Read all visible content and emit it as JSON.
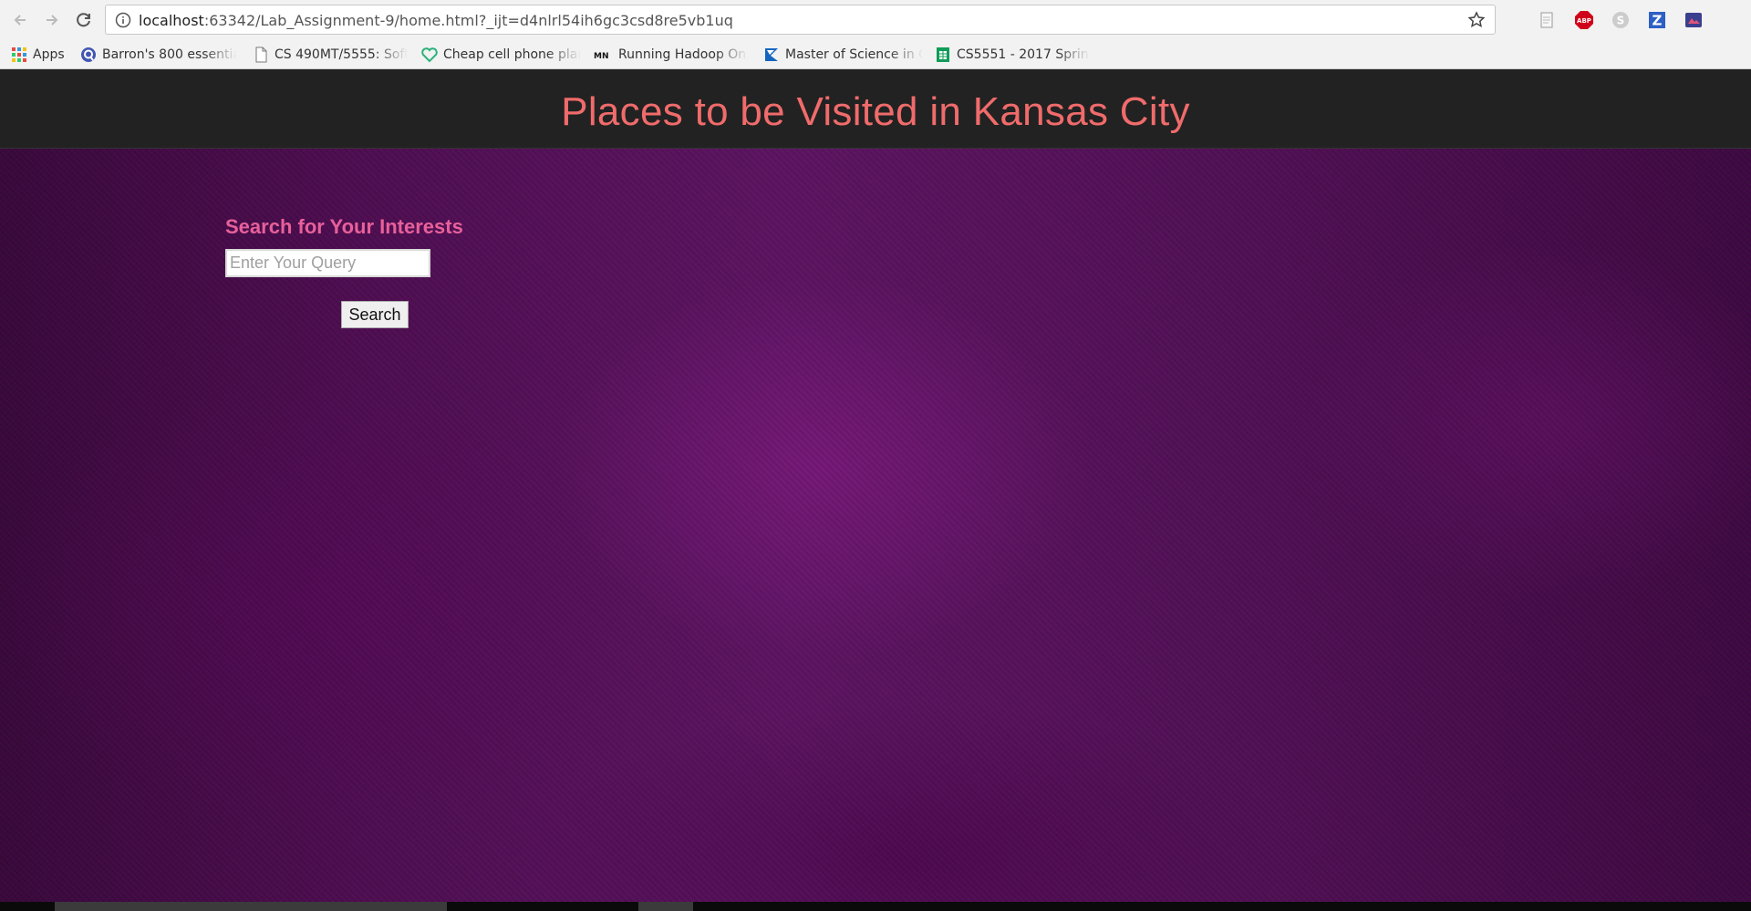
{
  "browser": {
    "url_host": "localhost",
    "url_rest": ":63342/Lab_Assignment-9/home.html?_ijt=d4nlrl54ih6gc3csd8re5vb1uq",
    "bookmarks": [
      {
        "label": "Apps",
        "icon": "apps-grid-icon"
      },
      {
        "label": "Barron's 800 essential",
        "icon": "quizlet-icon"
      },
      {
        "label": "CS 490MT/5555: Softw",
        "icon": "page-icon"
      },
      {
        "label": "Cheap cell phone plan",
        "icon": "heart-icon"
      },
      {
        "label": "Running Hadoop On U",
        "icon": "mn-icon"
      },
      {
        "label": "Master of Science in C",
        "icon": "flag-icon"
      },
      {
        "label": "CS5551 - 2017 Spring",
        "icon": "sheets-icon"
      }
    ],
    "extensions": [
      "reader-icon",
      "adblock-icon",
      "skype-icon",
      "zotero-icon",
      "extension-icon"
    ],
    "adblock_label": "ABP",
    "zotero_label": "Z",
    "mn_label": "MN"
  },
  "page": {
    "title": "Places to be Visited in Kansas City",
    "search_heading": "Search for Your Interests",
    "search_placeholder": "Enter Your Query",
    "search_value": "",
    "search_button": "Search"
  },
  "colors": {
    "header_bg": "#222222",
    "title_color": "#f06b6b",
    "heading_color": "#e8609a",
    "background_purple": "#5e1663"
  }
}
